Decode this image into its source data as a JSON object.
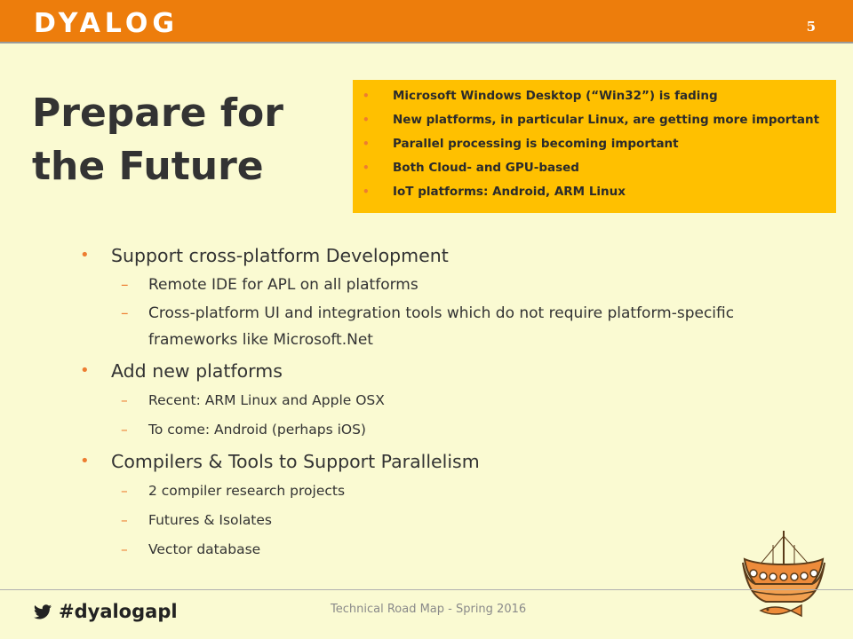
{
  "header": {
    "logo": "DYALOG",
    "slide_number": "5",
    "color": "#ed7d0c"
  },
  "title": {
    "line1": "Prepare for",
    "line2": "the Future"
  },
  "callout": {
    "color": "#ffc000",
    "items": [
      "Microsoft Windows Desktop (“Win32”) is fading",
      "New platforms, in particular Linux, are getting more important",
      "Parallel processing is becoming important",
      "Both Cloud- and GPU-based",
      "IoT platforms: Android, ARM Linux"
    ]
  },
  "bullets": [
    {
      "text": "Support cross-platform Development",
      "sub": [
        "Remote IDE for APL on all platforms",
        "Cross-platform UI and integration tools which do not require platform-specific frameworks like Microsoft.Net"
      ]
    },
    {
      "text": "Add new platforms",
      "sub": [
        "Recent: ARM Linux and Apple OSX",
        "To come: Android (perhaps iOS)"
      ]
    },
    {
      "text": "Compilers & Tools to Support Parallelism",
      "sub": [
        "2 compiler research projects",
        "Futures & Isolates",
        "Vector database"
      ]
    }
  ],
  "footer": {
    "hashtag": "#dyalogapl",
    "center_text": "Technical Road Map - Spring 2016"
  },
  "icons": {
    "twitter": "twitter-bird-icon",
    "ship": "viking-ship-icon"
  }
}
